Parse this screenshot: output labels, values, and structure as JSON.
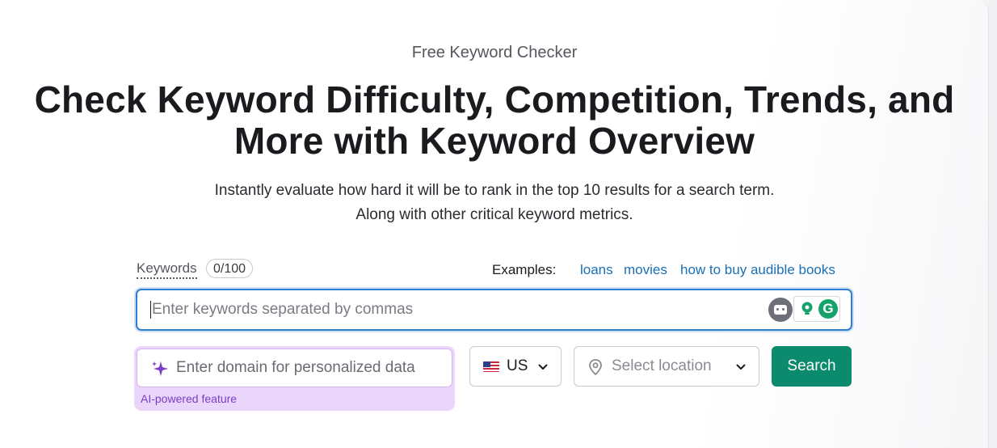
{
  "hero": {
    "kicker": "Free Keyword Checker",
    "title": "Check Keyword Difficulty, Competition, Trends, and More with Keyword Overview",
    "subtitle": "Instantly evaluate how hard it will be to rank in the top 10 results for a search term. Along with other critical keyword metrics."
  },
  "keywords": {
    "label": "Keywords",
    "count": "0/100",
    "placeholder": "Enter keywords separated by commas",
    "value": ""
  },
  "examples": {
    "label": "Examples:",
    "links": [
      "loans",
      "movies",
      "how to buy audible books"
    ]
  },
  "domain": {
    "placeholder": "Enter domain for personalized data",
    "value": "",
    "note": "AI-powered feature"
  },
  "country": {
    "code": "US"
  },
  "location": {
    "placeholder": "Select location"
  },
  "search": {
    "label": "Search"
  },
  "colors": {
    "accent_blue": "#2f7fd1",
    "link": "#1a6fb5",
    "search_button": "#0c8a6e",
    "ai_background": "#ead5fb",
    "ai_text": "#7b3ec6"
  }
}
